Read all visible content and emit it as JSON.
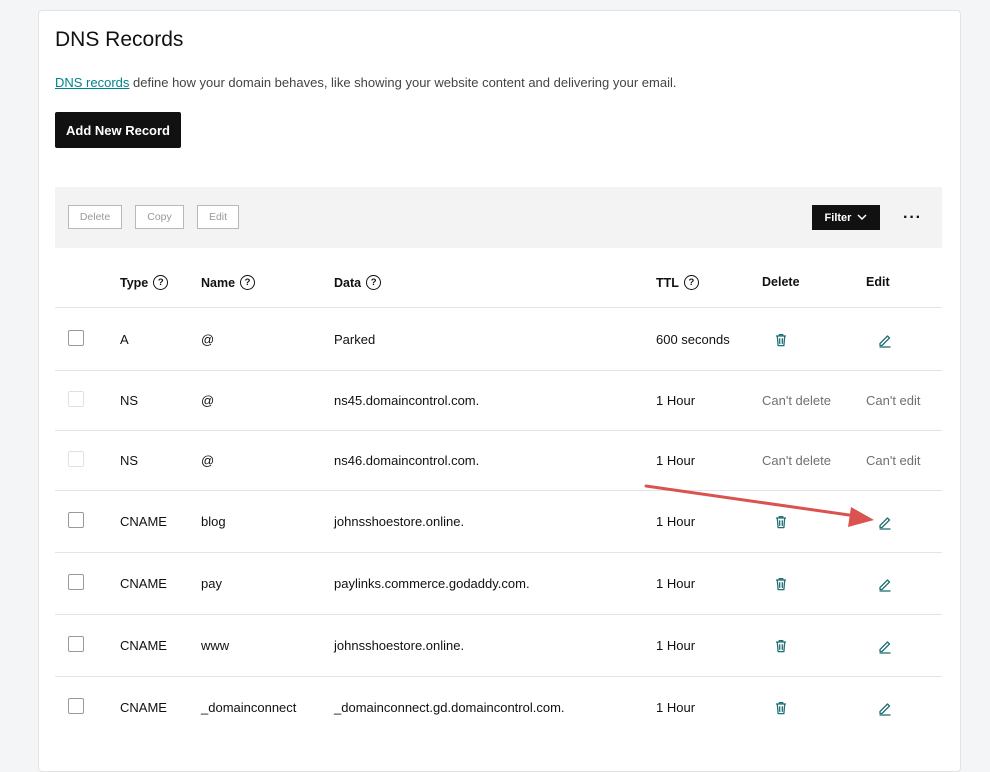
{
  "page": {
    "title": "DNS Records",
    "intro_link": "DNS records",
    "intro_text": " define how your domain behaves, like showing your website content and delivering your email.",
    "add_button": "Add New Record"
  },
  "toolbar": {
    "delete": "Delete",
    "copy": "Copy",
    "edit": "Edit",
    "filter": "Filter",
    "more": "···"
  },
  "columns": {
    "type": "Type",
    "name": "Name",
    "data": "Data",
    "ttl": "TTL",
    "delete": "Delete",
    "edit": "Edit"
  },
  "records": [
    {
      "type": "A",
      "name": "@",
      "data": "Parked",
      "ttl": "600 seconds",
      "delete": "",
      "edit": "",
      "locked": false
    },
    {
      "type": "NS",
      "name": "@",
      "data": "ns45.domaincontrol.com.",
      "ttl": "1 Hour",
      "delete": "Can't delete",
      "edit": "Can't edit",
      "locked": true
    },
    {
      "type": "NS",
      "name": "@",
      "data": "ns46.domaincontrol.com.",
      "ttl": "1 Hour",
      "delete": "Can't delete",
      "edit": "Can't edit",
      "locked": true
    },
    {
      "type": "CNAME",
      "name": "blog",
      "data": "johnsshoestore.online.",
      "ttl": "1 Hour",
      "delete": "",
      "edit": "",
      "locked": false
    },
    {
      "type": "CNAME",
      "name": "pay",
      "data": "paylinks.commerce.godaddy.com.",
      "ttl": "1 Hour",
      "delete": "",
      "edit": "",
      "locked": false
    },
    {
      "type": "CNAME",
      "name": "www",
      "data": "johnsshoestore.online.",
      "ttl": "1 Hour",
      "delete": "",
      "edit": "",
      "locked": false
    },
    {
      "type": "CNAME",
      "name": "_domainconnect",
      "data": "_domainconnect.gd.domaincontrol.com.",
      "ttl": "1 Hour",
      "delete": "",
      "edit": "",
      "locked": false
    }
  ],
  "colors": {
    "accent": "#00838c",
    "icon": "#1f6f73",
    "arrow": "#d9534f"
  },
  "icons": {
    "delete": "trash-icon",
    "edit": "pencil-icon",
    "help": "help-icon",
    "filter": "chevron-down-icon",
    "more": "more-icon"
  }
}
